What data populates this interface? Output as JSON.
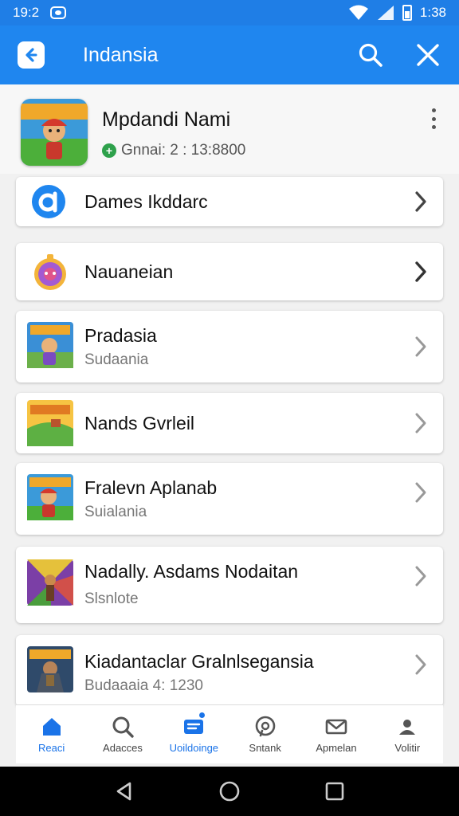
{
  "status_bar": {
    "time_left": "19:2",
    "time_right": "1:38"
  },
  "app_bar": {
    "title": "Indansia",
    "back_icon": "back-arrow-icon",
    "search_icon": "search-icon",
    "close_icon": "close-icon"
  },
  "header": {
    "title": "Mpdandi Nami",
    "subtitle": "Gnnai: 2 : 13:8800"
  },
  "rows": [
    {
      "title": "Dames Ikddarc",
      "sub": "",
      "icon": "app-logo-icon"
    },
    {
      "title": "Nauaneian",
      "sub": "",
      "icon": "clock-character-icon"
    },
    {
      "title": "Pradasia",
      "sub": "Sudaania",
      "icon": "game-thumb-icon"
    },
    {
      "title": "Nands Gvrleil",
      "sub": "",
      "icon": "game-thumb-icon"
    },
    {
      "title": "Fralevn Aplanab",
      "sub": "Suialania",
      "icon": "game-thumb-icon"
    },
    {
      "title": "Nadally. Asdams Nodaitan",
      "sub": "Slsnlote",
      "icon": "game-thumb-icon"
    },
    {
      "title": "Kiadantaclar Gralnlsegansia",
      "sub": "Budaaaia  4: 1230",
      "icon": "game-thumb-icon"
    }
  ],
  "bottom_nav": [
    {
      "label": "Reaci",
      "icon": "home-icon"
    },
    {
      "label": "Adacces",
      "icon": "search-icon"
    },
    {
      "label": "Uoildoinge",
      "icon": "message-icon"
    },
    {
      "label": "Sntank",
      "icon": "chat-icon"
    },
    {
      "label": "Apmelan",
      "icon": "mail-icon"
    },
    {
      "label": "Volitir",
      "icon": "person-icon"
    }
  ],
  "colors": {
    "primary": "#1f86ef",
    "status_bar": "#1f7ee6",
    "active_nav": "#1a73e8",
    "background": "#f1f1f1"
  }
}
